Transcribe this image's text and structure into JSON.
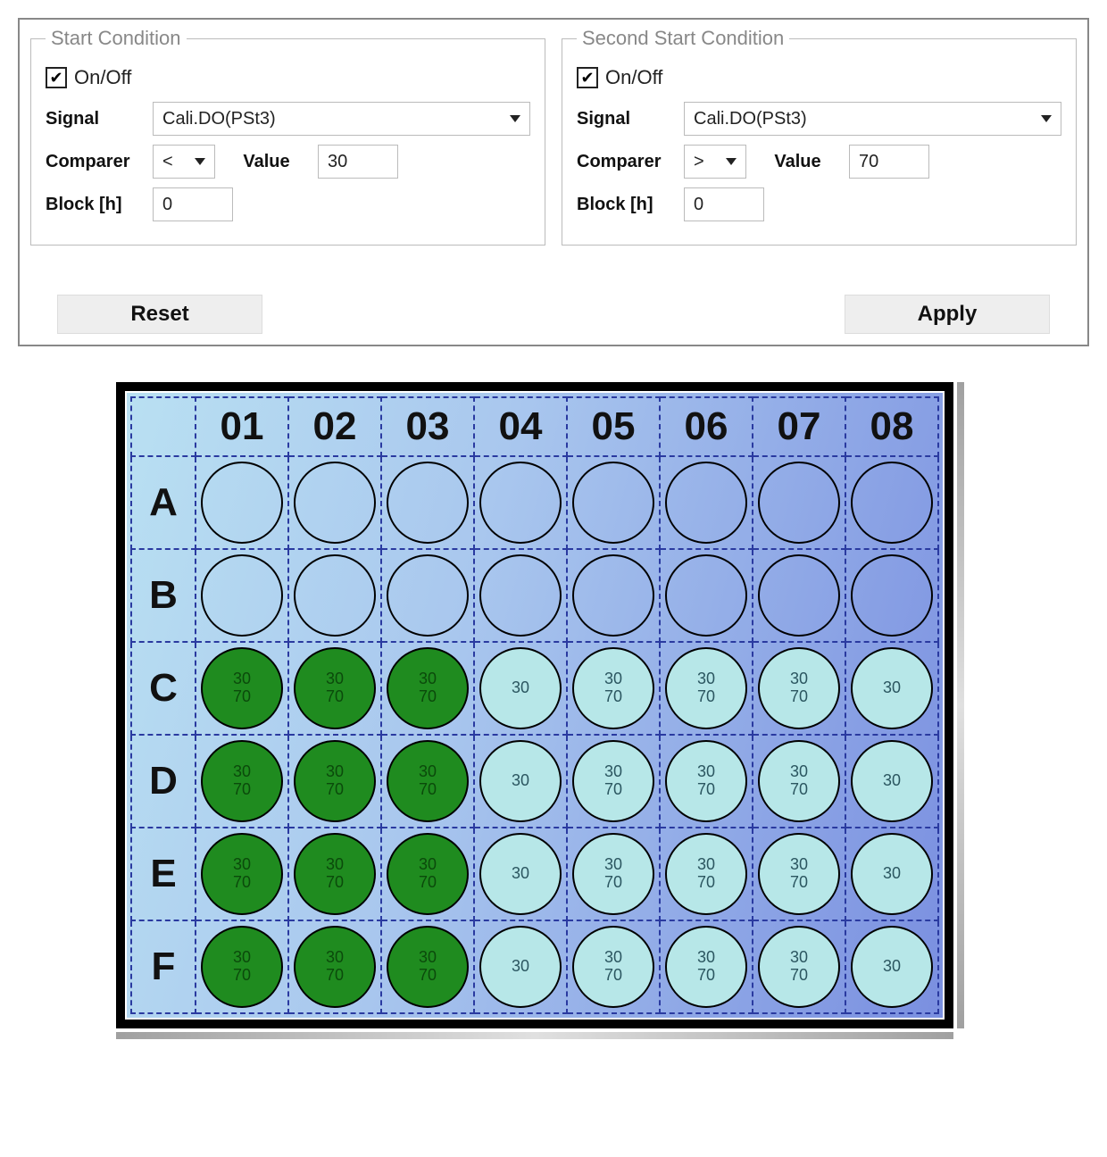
{
  "conditions": [
    {
      "legend": "Start Condition",
      "on": true,
      "onoff_label": "On/Off",
      "labels": {
        "signal": "Signal",
        "comparer": "Comparer",
        "value": "Value",
        "block": "Block [h]"
      },
      "signal": "Cali.DO(PSt3)",
      "comparer": "<",
      "value": "30",
      "block": "0"
    },
    {
      "legend": "Second Start Condition",
      "on": true,
      "onoff_label": "On/Off",
      "labels": {
        "signal": "Signal",
        "comparer": "Comparer",
        "value": "Value",
        "block": "Block [h]"
      },
      "signal": "Cali.DO(PSt3)",
      "comparer": ">",
      "value": "70",
      "block": "0"
    }
  ],
  "buttons": {
    "reset": "Reset",
    "apply": "Apply"
  },
  "checkmark": "✔",
  "plate": {
    "cols": [
      "01",
      "02",
      "03",
      "04",
      "05",
      "06",
      "07",
      "08"
    ],
    "rows": [
      "A",
      "B",
      "C",
      "D",
      "E",
      "F"
    ],
    "wells": {
      "A": [
        {
          "t": "empty"
        },
        {
          "t": "empty"
        },
        {
          "t": "empty"
        },
        {
          "t": "empty"
        },
        {
          "t": "empty"
        },
        {
          "t": "empty"
        },
        {
          "t": "empty"
        },
        {
          "t": "empty"
        }
      ],
      "B": [
        {
          "t": "empty"
        },
        {
          "t": "empty"
        },
        {
          "t": "empty"
        },
        {
          "t": "empty"
        },
        {
          "t": "empty"
        },
        {
          "t": "empty"
        },
        {
          "t": "empty"
        },
        {
          "t": "empty"
        }
      ],
      "C": [
        {
          "t": "green",
          "v": [
            "30",
            "70"
          ]
        },
        {
          "t": "green",
          "v": [
            "30",
            "70"
          ]
        },
        {
          "t": "green",
          "v": [
            "30",
            "70"
          ]
        },
        {
          "t": "cyan",
          "v": [
            "30"
          ]
        },
        {
          "t": "cyan",
          "v": [
            "30",
            "70"
          ]
        },
        {
          "t": "cyan",
          "v": [
            "30",
            "70"
          ]
        },
        {
          "t": "cyan",
          "v": [
            "30",
            "70"
          ]
        },
        {
          "t": "cyan",
          "v": [
            "30"
          ]
        }
      ],
      "D": [
        {
          "t": "green",
          "v": [
            "30",
            "70"
          ]
        },
        {
          "t": "green",
          "v": [
            "30",
            "70"
          ]
        },
        {
          "t": "green",
          "v": [
            "30",
            "70"
          ]
        },
        {
          "t": "cyan",
          "v": [
            "30"
          ]
        },
        {
          "t": "cyan",
          "v": [
            "30",
            "70"
          ]
        },
        {
          "t": "cyan",
          "v": [
            "30",
            "70"
          ]
        },
        {
          "t": "cyan",
          "v": [
            "30",
            "70"
          ]
        },
        {
          "t": "cyan",
          "v": [
            "30"
          ]
        }
      ],
      "E": [
        {
          "t": "green",
          "v": [
            "30",
            "70"
          ]
        },
        {
          "t": "green",
          "v": [
            "30",
            "70"
          ]
        },
        {
          "t": "green",
          "v": [
            "30",
            "70"
          ]
        },
        {
          "t": "cyan",
          "v": [
            "30"
          ]
        },
        {
          "t": "cyan",
          "v": [
            "30",
            "70"
          ]
        },
        {
          "t": "cyan",
          "v": [
            "30",
            "70"
          ]
        },
        {
          "t": "cyan",
          "v": [
            "30",
            "70"
          ]
        },
        {
          "t": "cyan",
          "v": [
            "30"
          ]
        }
      ],
      "F": [
        {
          "t": "green",
          "v": [
            "30",
            "70"
          ]
        },
        {
          "t": "green",
          "v": [
            "30",
            "70"
          ]
        },
        {
          "t": "green",
          "v": [
            "30",
            "70"
          ]
        },
        {
          "t": "cyan",
          "v": [
            "30"
          ]
        },
        {
          "t": "cyan",
          "v": [
            "30",
            "70"
          ]
        },
        {
          "t": "cyan",
          "v": [
            "30",
            "70"
          ]
        },
        {
          "t": "cyan",
          "v": [
            "30",
            "70"
          ]
        },
        {
          "t": "cyan",
          "v": [
            "30"
          ]
        }
      ]
    }
  }
}
